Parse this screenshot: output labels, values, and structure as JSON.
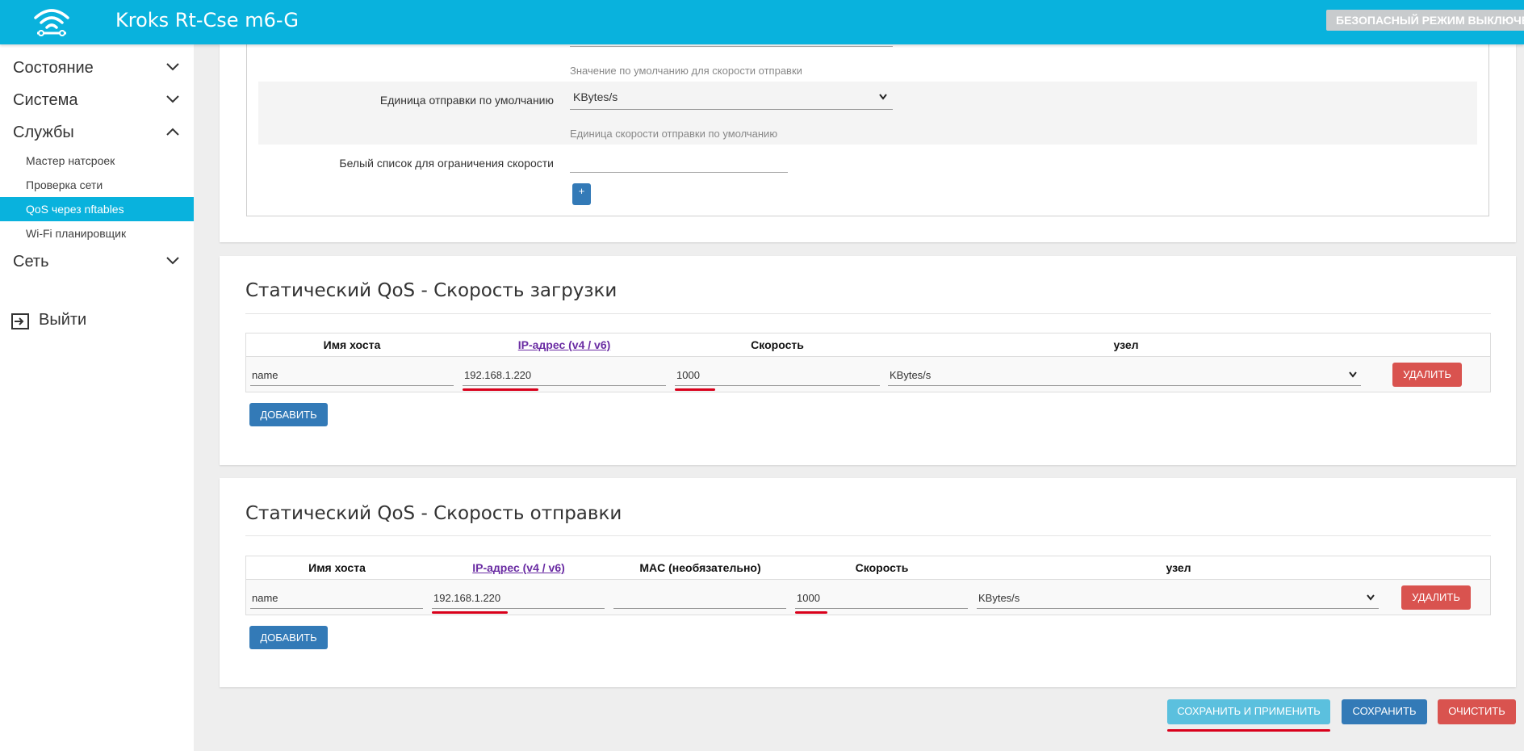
{
  "header": {
    "title": "Kroks Rt-Cse m6-G",
    "safe_mode": "БЕЗОПАСНЫЙ РЕЖИМ ВЫКЛЮЧЕН",
    "bg_color": "#09b2dd"
  },
  "sidebar": {
    "items": [
      {
        "label": "Состояние",
        "icon": "chevron-down-icon"
      },
      {
        "label": "Система",
        "icon": "chevron-down-icon"
      },
      {
        "label": "Службы",
        "icon": "chevron-up-icon"
      },
      {
        "label": "Сеть",
        "icon": "chevron-down-icon"
      }
    ],
    "sub_items": [
      {
        "label": "Мастер натсроек"
      },
      {
        "label": "Проверка сети"
      },
      {
        "label": "QoS через nftables",
        "active": true
      },
      {
        "label": "Wi-Fi планировщик"
      }
    ],
    "logout": "Выйти"
  },
  "top_panel": {
    "upload_default_hint": "Значение по умолчанию для скорости отправки",
    "unit_label": "Единица отправки по умолчанию",
    "unit_value": "KBytes/s",
    "unit_hint": "Единица скорости отправки по умолчанию",
    "whitelist_label": "Белый список для ограничения скорости",
    "add_plus": "+"
  },
  "download_section": {
    "title": "Статический QoS - Скорость загрузки",
    "columns": [
      "Имя хоста",
      "IP-адрес (v4 / v6)",
      "Скорость",
      "узел"
    ],
    "row": {
      "hostname": "name",
      "ip": "192.168.1.220",
      "speed": "1000",
      "unit": "KBytes/s"
    },
    "delete_button": "УДАЛИТЬ",
    "add_button": "ДОБАВИТЬ"
  },
  "upload_section": {
    "title": "Статический QoS - Скорость отправки",
    "columns": [
      "Имя хоста",
      "IP-адрес (v4 / v6)",
      "MAC (необязательно)",
      "Скорость",
      "узел"
    ],
    "row": {
      "hostname": "name",
      "ip": "192.168.1.220",
      "mac": "",
      "speed": "1000",
      "unit": "KBytes/s"
    },
    "delete_button": "УДАЛИТЬ",
    "add_button": "ДОБАВИТЬ"
  },
  "footer": {
    "save_apply": "СОХРАНИТЬ И ПРИМЕНИТЬ",
    "save": "СОХРАНИТЬ",
    "reset": "ОЧИСТИТЬ"
  },
  "colors": {
    "accent": "#09b2dd",
    "danger": "#d9534f",
    "primary": "#337ab7",
    "info": "#5bc0de",
    "annotation": "#d9001b"
  }
}
